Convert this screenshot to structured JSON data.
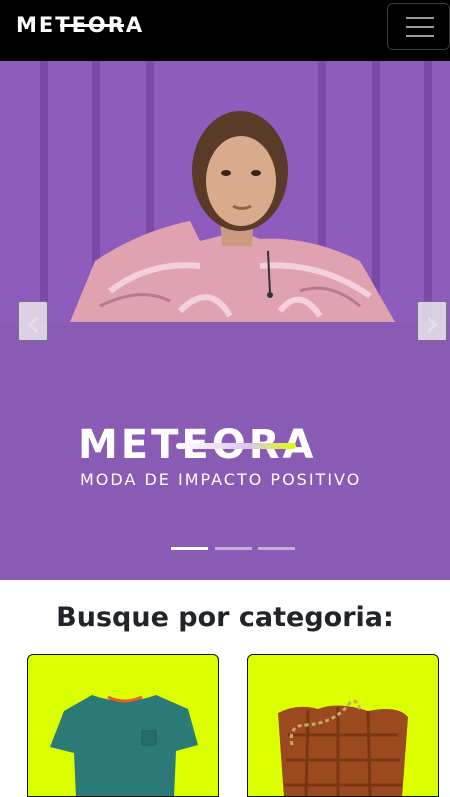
{
  "navbar": {
    "brand": "METEORA",
    "menu_icon": "hamburger-menu-icon"
  },
  "carousel": {
    "banner_brand": "METEORA",
    "tagline": "MODA DE IMPACTO POSITIVO",
    "prev_icon": "chevron-left-icon",
    "next_icon": "chevron-right-icon",
    "slide_count": 3,
    "active_slide": 1,
    "colors": {
      "background": "#8a5bb5",
      "accent": "#dcff00"
    }
  },
  "categories": {
    "title": "Busque por categoria:",
    "cards": [
      {
        "image": "teal-tshirt",
        "background": "#dcff00"
      },
      {
        "image": "brown-woven-bag",
        "background": "#dcff00"
      }
    ]
  }
}
